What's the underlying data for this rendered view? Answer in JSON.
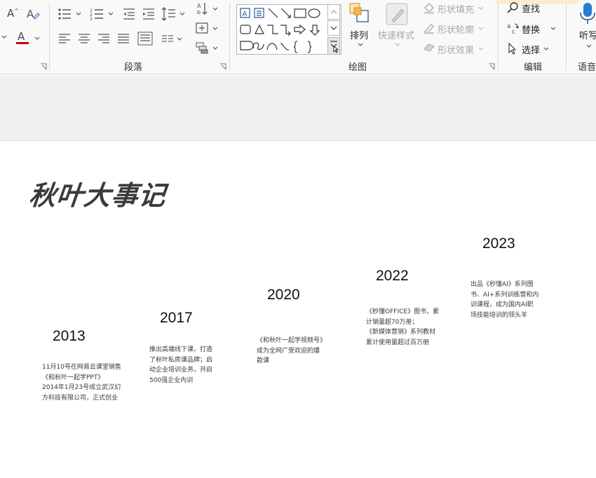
{
  "ribbon": {
    "groups": {
      "paragraph": "段落",
      "drawing": "绘图",
      "editing": "编辑",
      "voice": "语音"
    },
    "arrange": {
      "label": "排列"
    },
    "quick_styles": {
      "label": "快速样式"
    },
    "shape_fill": {
      "label": "形状填充"
    },
    "shape_outline": {
      "label": "形状轮廓"
    },
    "shape_effects": {
      "label": "形状效果"
    },
    "find": {
      "label": "查找"
    },
    "replace": {
      "label": "替换"
    },
    "select": {
      "label": "选择"
    },
    "dictate": {
      "label": "听写"
    },
    "font_size_label": "A",
    "font_color_label": "A"
  },
  "slide": {
    "title": "秋叶大事记",
    "milestones": [
      {
        "year": "2013",
        "lines": [
          "11月10号在网易云课堂销售",
          "《和秋叶一起学PPT》",
          "2014年1月23号成立武汉幻",
          "方科技有限公司，正式创业"
        ]
      },
      {
        "year": "2017",
        "lines": [
          "推出高端线下课，打造",
          "了秋叶私房课品牌；启",
          "动企业培训业务，开启",
          "500强企业内训"
        ]
      },
      {
        "year": "2020",
        "lines": [
          "《和秋叶一起学视频号》",
          "成为全网广受欢迎的爆",
          "款课"
        ]
      },
      {
        "year": "2022",
        "lines": [
          "《秒懂OFFICE》图书，累",
          "计销量超70万册；",
          "《新媒体营销》系列教材",
          "累计使用量超过百万册"
        ]
      },
      {
        "year": "2023",
        "lines": [
          "出品《秒懂AI》系列图",
          "书、AI+系列训练营和内",
          "训课程，成为国内AI职",
          "场技能培训的领头羊"
        ]
      }
    ]
  }
}
